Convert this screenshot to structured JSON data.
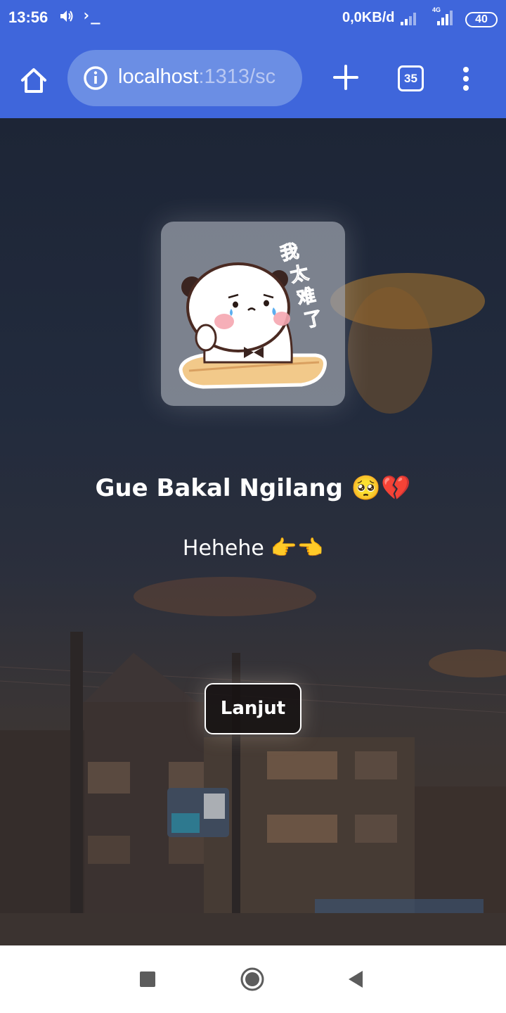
{
  "status_bar": {
    "time": "13:56",
    "terminal_glyph": "›_",
    "data_rate": "0,0KB/d",
    "network_type": "4G",
    "battery": "40"
  },
  "browser": {
    "url_host": "localhost",
    "url_rest": ":1313/sc",
    "tab_count": "35",
    "accent_color": "#3f66db"
  },
  "page": {
    "sticker_text": "我太难了",
    "title": "Gue Bakal Ngilang 🥺💔",
    "subtitle": "Hehehe 👉👈",
    "button_label": "Lanjut"
  },
  "icons": {
    "home": "home-icon",
    "info": "info-icon",
    "new_tab": "plus-icon",
    "tabs": "tab-switcher-icon",
    "menu": "more-vert-icon",
    "nav_recents": "square-icon",
    "nav_home": "circle-icon",
    "nav_back": "back-triangle-icon"
  }
}
